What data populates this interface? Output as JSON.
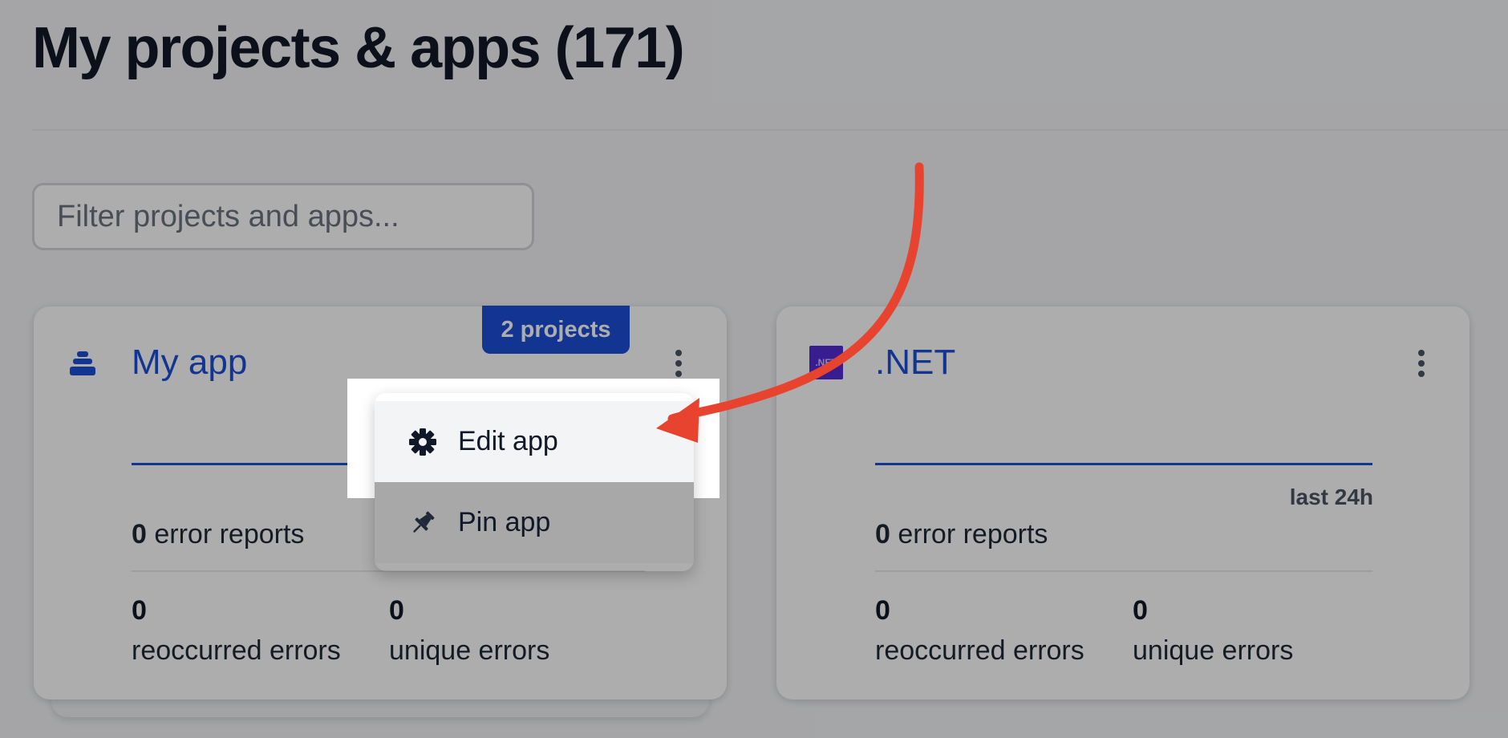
{
  "header": {
    "title": "My projects & apps (171)"
  },
  "filter": {
    "placeholder": "Filter projects and apps..."
  },
  "cards": [
    {
      "name": "My app",
      "badge": "2 projects",
      "icon": "layers-stack-icon",
      "error_reports_count": "0",
      "error_reports_label": "error reports",
      "reoccurred_count": "0",
      "reoccurred_label": "reoccurred errors",
      "unique_count": "0",
      "unique_label": "unique errors"
    },
    {
      "name": ".NET",
      "icon": "dotnet-logo-icon",
      "icon_text": ".NET",
      "period": "last 24h",
      "error_reports_count": "0",
      "error_reports_label": "error reports",
      "reoccurred_count": "0",
      "reoccurred_label": "reoccurred errors",
      "unique_count": "0",
      "unique_label": "unique errors"
    }
  ],
  "menu": {
    "items": [
      {
        "label": "Edit app",
        "icon": "gear-icon"
      },
      {
        "label": "Pin app",
        "icon": "pin-icon"
      }
    ]
  },
  "colors": {
    "accent": "#1d4ed8",
    "annotation_arrow": "#e8432e",
    "dotnet_brand": "#512bd4"
  }
}
